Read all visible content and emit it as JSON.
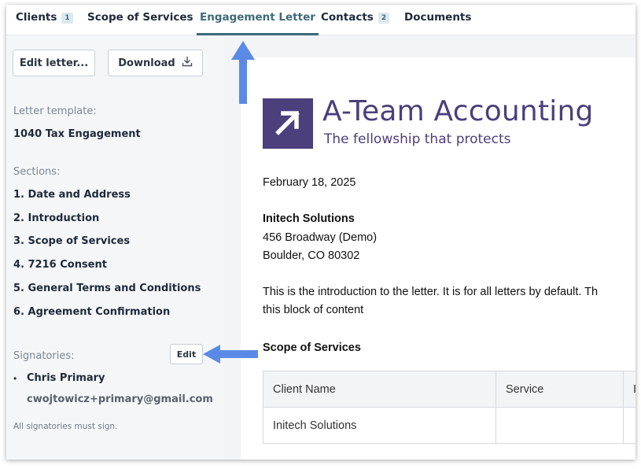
{
  "tabs": [
    {
      "label": "Clients",
      "badge": "1"
    },
    {
      "label": "Scope of Services"
    },
    {
      "label": "Engagement Letter",
      "active": true
    },
    {
      "label": "Contacts",
      "badge": "2"
    },
    {
      "label": "Documents"
    }
  ],
  "sidebar": {
    "edit_letter_label": "Edit letter...",
    "download_label": "Download",
    "template_label": "Letter template:",
    "template_value": "1040 Tax Engagement",
    "sections_label": "Sections:",
    "sections": [
      "1. Date and Address",
      "2. Introduction",
      "3. Scope of Services",
      "4. 7216 Consent",
      "5. General Terms and Conditions",
      "6. Agreement Confirmation"
    ],
    "signatories_label": "Signatories:",
    "edit_label": "Edit",
    "signatory_name": "Chris Primary",
    "signatory_email": "cwojtowicz+primary@gmail.com",
    "sign_note": "All signatories must sign."
  },
  "letter": {
    "company_name": "A-Team Accounting",
    "tagline": "The fellowship that protects",
    "date": "February 18, 2025",
    "client_name": "Initech Solutions",
    "address_line1": "456 Broadway (Demo)",
    "address_line2": "Boulder, CO 80302",
    "intro_line1": "This is the introduction to the letter. It is for all letters by default. Th",
    "intro_line2": "this block of content",
    "scope_heading": "Scope of Services",
    "table": {
      "headers": [
        "Client Name",
        "Service",
        "I"
      ],
      "rows": [
        [
          "Initech Solutions",
          "",
          ""
        ]
      ]
    }
  },
  "colors": {
    "accent": "#3d6a78",
    "brand": "#4b3f7c",
    "annotation_arrow": "#5b8ae6"
  },
  "icons": {
    "download": "download-icon",
    "logo": "arrow-up-right-icon"
  }
}
